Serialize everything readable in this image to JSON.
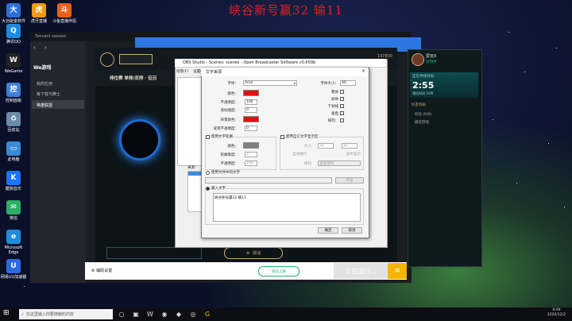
{
  "overlay_title": "峡谷新号赢32 输11",
  "desktop_icons": [
    {
      "label": "大功能金软件",
      "color": "#2d6fd8",
      "glyph": "大"
    },
    {
      "label": "虎牙直播",
      "color": "#f19a18",
      "glyph": "虎"
    },
    {
      "label": "斗鱼直播伴侣",
      "color": "#e7621e",
      "glyph": "斗"
    },
    {
      "label": "腾讯QQ",
      "color": "#1e8be0",
      "glyph": "Q"
    },
    {
      "label": "WeGame",
      "color": "#222",
      "glyph": "W"
    },
    {
      "label": "控制面板",
      "color": "#3b7fd6",
      "glyph": "控"
    },
    {
      "label": "回收站",
      "color": "#6b8ba8",
      "glyph": "♻"
    },
    {
      "label": "此电脑",
      "color": "#3a8ad8",
      "glyph": "▭"
    },
    {
      "label": "酷狗音乐",
      "color": "#1a75ff",
      "glyph": "K"
    },
    {
      "label": "微信",
      "color": "#2aae67",
      "glyph": "✉"
    },
    {
      "label": "Microsoft Edge",
      "color": "#1f8bdc",
      "glyph": "e"
    },
    {
      "label": "网易UU加速器",
      "color": "#2b6ae0",
      "glyph": "U"
    }
  ],
  "wegame": {
    "title": "Tencent session",
    "brand": "We游戏",
    "side_items": [
      "我的应用",
      "每下载与腾士",
      "英雄联盟"
    ]
  },
  "lol": {
    "mode": "排位赛 单排/双排 · 征召",
    "currency": "197800",
    "start_button": "取消"
  },
  "obs": {
    "title": "OBS Studio - Scenes: scenes - Open Broadcaster Software v0.659b",
    "menu": [
      "场景(F)",
      "设置(S)"
    ],
    "sources_label": "来源："
  },
  "text_dialog": {
    "title": "文字来源",
    "font_label": "字体：",
    "font_value": "Arial",
    "font_size_label": "字体大小：",
    "font_size_value": "40",
    "color_label": "颜色：",
    "opacity_label": "不透明度：",
    "opacity_value": "100",
    "scroll_speed_label": "滚动速度：",
    "scroll_speed_value": "0",
    "bg_color_label": "背景颜色：",
    "bg_opacity_label": "背景不透明度：",
    "bg_opacity_value": "0",
    "bold_label": "粗体",
    "italic_label": "斜体",
    "underline_label": "下划线",
    "vertical_label": "垂直",
    "outline_text_label": "使用文字轮廓",
    "outline_color_label": "颜色：",
    "outline_thickness_label": "轮廓厚度：",
    "outline_thickness_value": "2",
    "outline_opacity_label": "不透明度：",
    "outline_opacity_value": "100",
    "custom_region_label": "使用自订文字显示区",
    "size_label": "大小：",
    "size_w": "32",
    "size_h": "32",
    "auto_wrap_label": "自动换行",
    "align_label": "居中显示",
    "file_text_label": "使用文件中的文字",
    "browse_label": "浏览",
    "input_text_label": "输入文字",
    "input_text_value": "峡谷新号赢32 输11",
    "extra_label": "排列：",
    "extra_value": "垂直排列",
    "ok": "确定",
    "cancel": "取消",
    "color_hex": "#e01010",
    "bg_color_hex": "#e01010",
    "outline_color_hex": "#808080"
  },
  "right_panel": {
    "username": "爱玩9",
    "status": "队列中",
    "queue_title": "正在寻找对局",
    "timer": "2:55",
    "queue_sub": "预估时间 3:06",
    "social_label": "好友列表",
    "groups": [
      "综合 (0/8)",
      "最近游戏"
    ]
  },
  "bottom": {
    "settings_label": "辅助设置",
    "status_pill": "排位之路",
    "running_label": "正在运行..."
  },
  "taskbar": {
    "search_placeholder": "在这里输入你要搜索的内容",
    "clock_time": "9:49",
    "clock_date": "2020/12/2"
  }
}
